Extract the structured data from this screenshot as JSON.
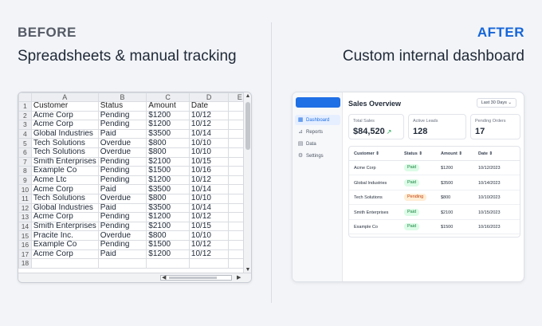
{
  "labels": {
    "before": "BEFORE",
    "after": "AFTER",
    "before_caption": "Spreadsheets & manual tracking",
    "after_caption": "Custom internal dashboard"
  },
  "spreadsheet": {
    "columns": [
      "A",
      "B",
      "C",
      "D",
      "E"
    ],
    "rows": [
      [
        "Customer",
        "Status",
        "Amount",
        "Date"
      ],
      [
        "Acme Corp",
        "Pending",
        "$1200",
        "10/12"
      ],
      [
        "Acme Corp",
        "Pending",
        "$1200",
        "10/12"
      ],
      [
        "Global Industries",
        "Paid",
        "$3500",
        "10/14"
      ],
      [
        "Tech Solutions",
        "Overdue",
        "$800",
        "10/10"
      ],
      [
        "Tech Solutions",
        "Overdue",
        "$800",
        "10/10"
      ],
      [
        "Smith Enterprises",
        "Pending",
        "$2100",
        "10/15"
      ],
      [
        "Example Co",
        "Pending",
        "$1500",
        "10/16"
      ],
      [
        "Acme Ltc",
        "Pending",
        "$1200",
        "10/12"
      ],
      [
        "Acme Corp",
        "Paid",
        "$3500",
        "10/14"
      ],
      [
        "Tech Solutions",
        "Overdue",
        "$800",
        "10/10"
      ],
      [
        "Global Industries",
        "Paid",
        "$3500",
        "10/14"
      ],
      [
        "Acme Corp",
        "Pending",
        "$1200",
        "10/12"
      ],
      [
        "Smith Enterprises",
        "Pending",
        "$2100",
        "10/15"
      ],
      [
        "Pracite Inc.",
        "Overdue",
        "$800",
        "10/10"
      ],
      [
        "Example Co",
        "Pending",
        "$1500",
        "10/12"
      ],
      [
        "Acme Corp",
        "Paid",
        "$1200",
        "10/12"
      ],
      [
        "",
        "",
        "",
        ""
      ]
    ]
  },
  "dashboard": {
    "title": "Sales Overview",
    "date_range": "Last 30 Days",
    "nav": [
      {
        "label": "Dashboard",
        "icon": "grid-icon",
        "active": true
      },
      {
        "label": "Reports",
        "icon": "chart-icon",
        "active": false
      },
      {
        "label": "Data",
        "icon": "database-icon",
        "active": false
      },
      {
        "label": "Settings",
        "icon": "gear-icon",
        "active": false
      }
    ],
    "cards": [
      {
        "label": "Total Sales",
        "value": "$84,520"
      },
      {
        "label": "Active Leads",
        "value": "128"
      },
      {
        "label": "Pending Orders",
        "value": "17"
      }
    ],
    "table": {
      "headers": [
        "Customer",
        "Status",
        "Amount",
        "Date"
      ],
      "rows": [
        {
          "customer": "Acme Corp",
          "status": "Paid",
          "amount": "$1200",
          "date": "10/12/2023"
        },
        {
          "customer": "Global Industries",
          "status": "Paid",
          "amount": "$3500",
          "date": "10/14/2023"
        },
        {
          "customer": "Tech Solutions",
          "status": "Pending",
          "amount": "$800",
          "date": "10/10/2023"
        },
        {
          "customer": "Smith Enterprises",
          "status": "Paid",
          "amount": "$2100",
          "date": "10/15/2023"
        },
        {
          "customer": "Example Co",
          "status": "Paid",
          "amount": "$1500",
          "date": "10/16/2023"
        }
      ]
    }
  },
  "colors": {
    "accent": "#1f6fe5",
    "after_heading": "#1565d8",
    "paid": "#15803d",
    "pending": "#c2410c"
  }
}
